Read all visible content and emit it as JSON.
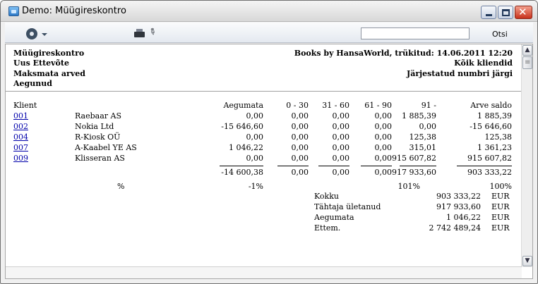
{
  "window": {
    "title": "Demo: Müügireskontro",
    "search_value": "",
    "search_label": "Otsi"
  },
  "header": {
    "left": [
      "Müügireskontro",
      "Uus Ettevõte",
      "Maksmata arved",
      "Aegunud"
    ],
    "right": [
      "Books by HansaWorld, trükitud: 14.06.2011 12:20",
      "Kõik kliendid",
      "Järjestatud numbri järgi"
    ]
  },
  "columns": {
    "klient": "Klient",
    "aegumata": "Aegumata",
    "c0_30": "0 - 30",
    "c31_60": "31 - 60",
    "c61_90": "61 - 90",
    "c91": "91 -",
    "arve_saldo": "Arve saldo"
  },
  "rows": [
    {
      "code": "001",
      "name": "Raebaar AS",
      "aegumata": "0,00",
      "c0_30": "0,00",
      "c31_60": "0,00",
      "c61_90": "0,00",
      "c91": "1 885,39",
      "saldo": "1 885,39"
    },
    {
      "code": "002",
      "name": "Nokia Ltd",
      "aegumata": "-15 646,60",
      "c0_30": "0,00",
      "c31_60": "0,00",
      "c61_90": "0,00",
      "c91": "0,00",
      "saldo": "-15 646,60"
    },
    {
      "code": "004",
      "name": "R-Kiosk OÜ",
      "aegumata": "0,00",
      "c0_30": "0,00",
      "c31_60": "0,00",
      "c61_90": "0,00",
      "c91": "125,38",
      "saldo": "125,38"
    },
    {
      "code": "007",
      "name": "A-Kaabel YE AS",
      "aegumata": "1 046,22",
      "c0_30": "0,00",
      "c31_60": "0,00",
      "c61_90": "0,00",
      "c91": "315,01",
      "saldo": "1 361,23"
    },
    {
      "code": "009",
      "name": "Klisseran AS",
      "aegumata": "0,00",
      "c0_30": "0,00",
      "c31_60": "0,00",
      "c61_90": "0,00",
      "c91": "915 607,82",
      "saldo": "915 607,82"
    }
  ],
  "totals": {
    "aegumata": "-14 600,38",
    "c0_30": "0,00",
    "c31_60": "0,00",
    "c61_90": "0,00",
    "c91": "917 933,60",
    "saldo": "903 333,22"
  },
  "percent": {
    "label": "%",
    "aegumata": "-1%",
    "c91": "101%",
    "saldo": "100%"
  },
  "summary": [
    {
      "label": "Kokku",
      "value": "903 333,22",
      "cur": "EUR"
    },
    {
      "label": "Tähtaja ületanud",
      "value": "917 933,60",
      "cur": "EUR"
    },
    {
      "label": "Aegumata",
      "value": "1 046,22",
      "cur": "EUR"
    },
    {
      "label": "Ettem.",
      "value": "2 742 489,24",
      "cur": "EUR"
    }
  ]
}
